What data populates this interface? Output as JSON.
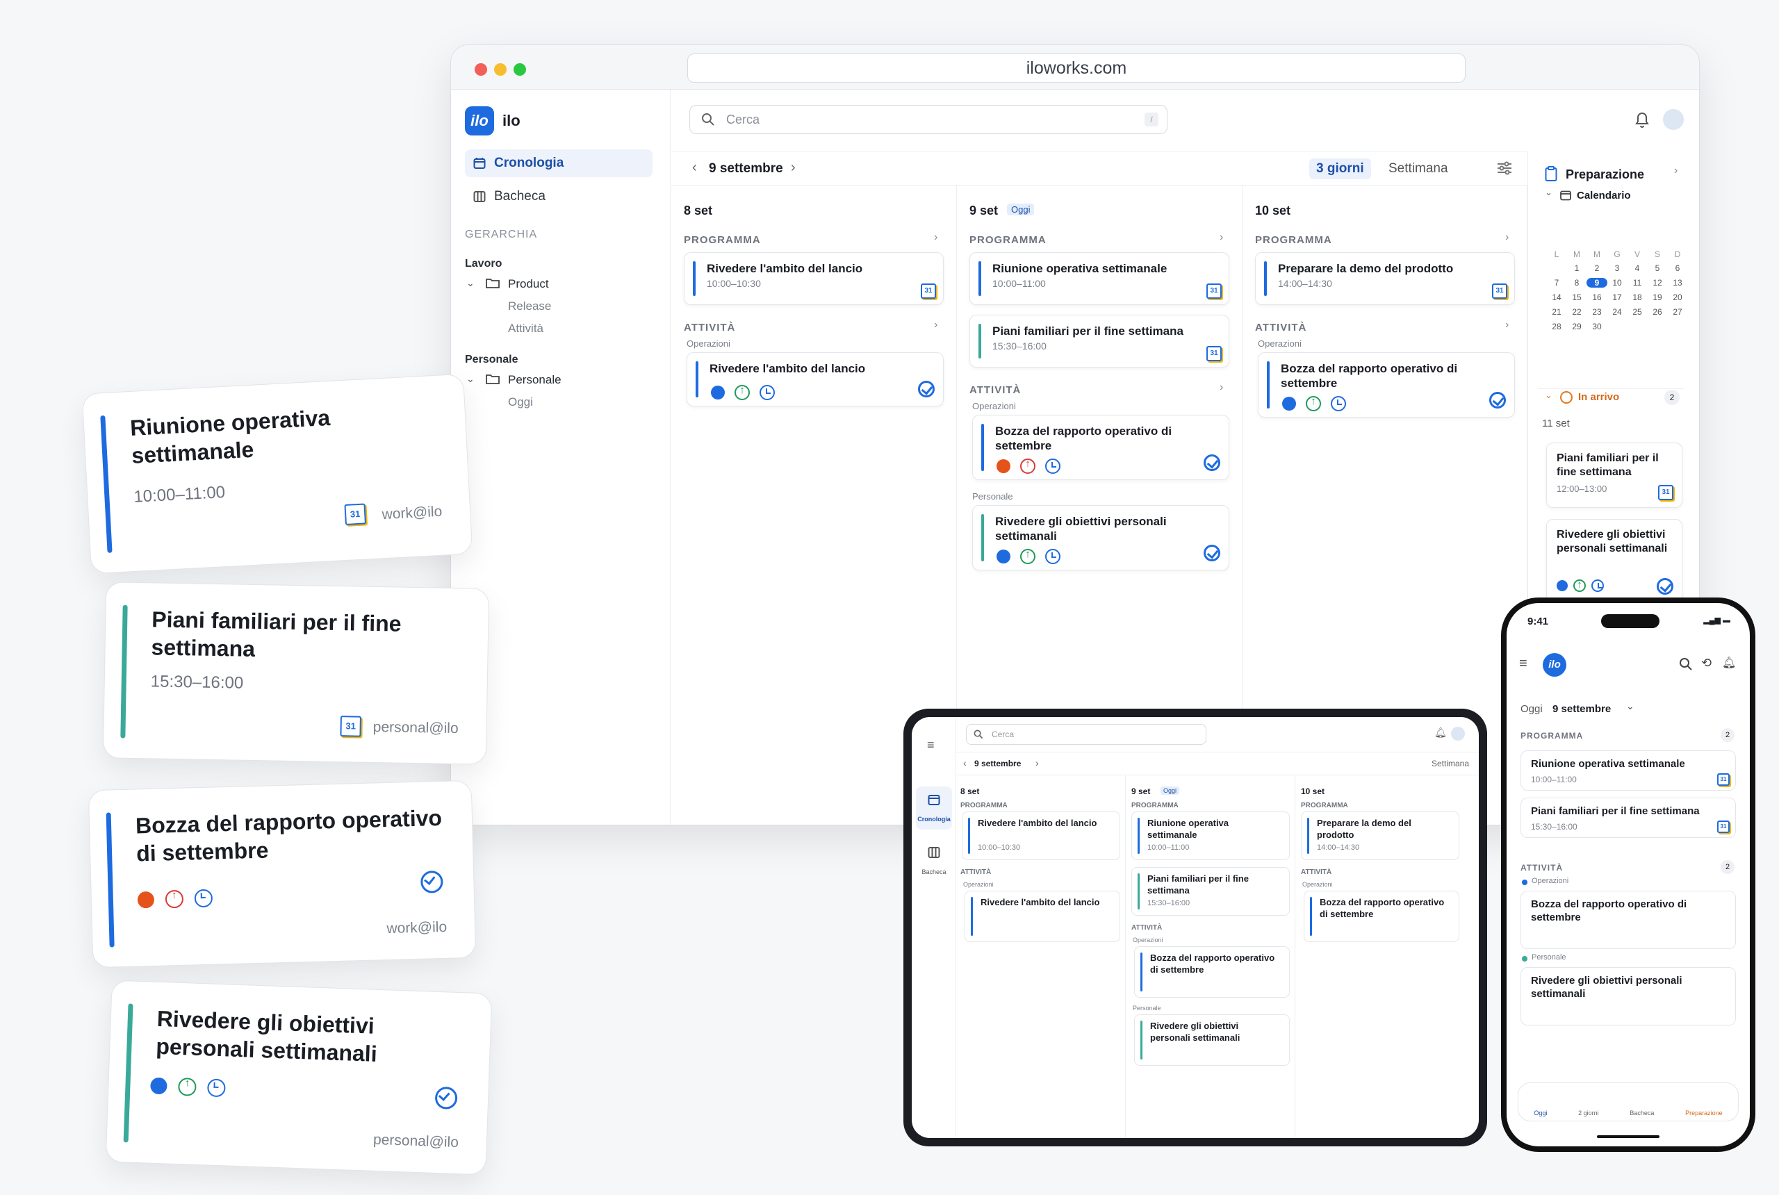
{
  "browser": {
    "url": "iloworks.com"
  },
  "app": {
    "logo": "ilo",
    "name": "ilo"
  },
  "sidebar": {
    "nav": [
      {
        "label": "Cronologia"
      },
      {
        "label": "Bacheca"
      }
    ],
    "hierarchy_label": "GERARCHIA",
    "groups": [
      {
        "label": "Lavoro",
        "folder": "Product",
        "items": [
          "Release",
          "Attività"
        ]
      },
      {
        "label": "Personale",
        "folder": "Personale",
        "items": [
          "Oggi"
        ]
      }
    ]
  },
  "search": {
    "placeholder": "Cerca",
    "shortcut": "/"
  },
  "toolbar": {
    "date": "9 settembre",
    "view_3days": "3 giorni",
    "view_week": "Settimana"
  },
  "days": [
    {
      "title": "8 set",
      "today": "",
      "program_label": "PROGRAMMA",
      "activity_label": "ATTIVITÀ"
    },
    {
      "title": "9 set",
      "today": "Oggi",
      "program_label": "PROGRAMMA",
      "activity_label": "ATTIVITÀ"
    },
    {
      "title": "10 set",
      "today": "",
      "program_label": "PROGRAMMA",
      "activity_label": "ATTIVITÀ"
    }
  ],
  "events": {
    "e1": {
      "title": "Rivedere l'ambito del lancio",
      "time": "10:00–10:30"
    },
    "e2": {
      "title": "Riunione operativa settimanale",
      "time": "10:00–11:00"
    },
    "e3": {
      "title": "Piani familiari per il fine settimana",
      "time": "15:30–16:00"
    },
    "e4": {
      "title": "Preparare la demo del prodotto",
      "time": "14:00–14:30"
    },
    "t1": {
      "title": "Rivedere l'ambito del lancio"
    },
    "t2": {
      "title": "Bozza del rapporto operativo di settembre"
    },
    "t3": {
      "title": "Rivedere gli obiettivi personali settimanali"
    }
  },
  "groups_labels": {
    "ops": "Operazioni",
    "personal": "Personale"
  },
  "gcal_label": "31",
  "right_panel": {
    "title": "Preparazione",
    "calendar_label": "Calendario",
    "weekdays": [
      "L",
      "M",
      "M",
      "G",
      "V",
      "S",
      "D"
    ],
    "dates": [
      "",
      "1",
      "2",
      "3",
      "4",
      "5",
      "6",
      "7",
      "8",
      "9",
      "10",
      "11",
      "12",
      "13",
      "14",
      "15",
      "16",
      "17",
      "18",
      "19",
      "20",
      "21",
      "22",
      "23",
      "24",
      "25",
      "26",
      "27",
      "28",
      "29",
      "30"
    ],
    "selected_date": "9",
    "upcoming_label": "In arrivo",
    "upcoming_count": "2",
    "upcoming_date": "11 set",
    "up1_title": "Piani familiari per il fine settimana",
    "up1_time": "12:00–13:00",
    "up2_title": "Rivedere gli obiettivi personali settimanali"
  },
  "floating": {
    "f1": {
      "title": "Riunione operativa settimanale",
      "time": "10:00–11:00",
      "account": "work@ilo"
    },
    "f2": {
      "title": "Piani familiari per il fine settimana",
      "time": "15:30–16:00",
      "account": "personal@ilo"
    },
    "f3": {
      "title": "Bozza del rapporto operativo di settembre",
      "account": "work@ilo"
    },
    "f4": {
      "title": "Rivedere gli obiettivi personali settimanali",
      "account": "personal@ilo"
    }
  },
  "tablet": {
    "search": "Cerca",
    "date": "9 settembre",
    "view": "Settimana",
    "nav1": "Cronologia",
    "nav2": "Bacheca"
  },
  "phone": {
    "time": "9:41",
    "today": "Oggi",
    "date": "9 settembre",
    "program_label": "PROGRAMMA",
    "program_count": "2",
    "activity_label": "ATTIVITÀ",
    "activity_count": "2",
    "tabs": [
      "Oggi",
      "2 giorni",
      "Bacheca",
      "Preparazione"
    ]
  },
  "colors": {
    "accent": "#1e6be0",
    "teal": "#3aa99a",
    "orange": "#e5531b",
    "red": "#d93a3a",
    "green": "#1f9a5a"
  }
}
